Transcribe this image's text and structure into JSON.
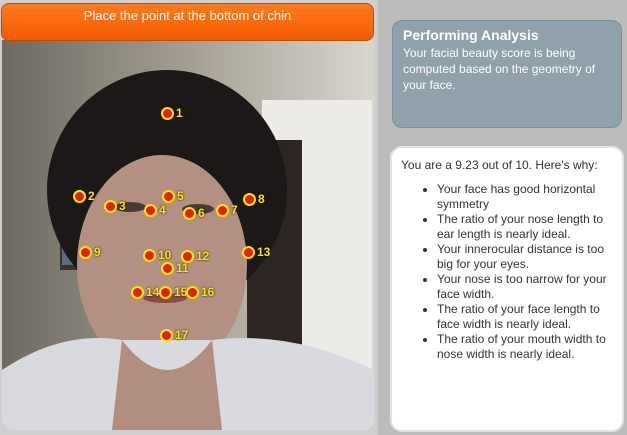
{
  "instruction_banner": "Place the point at the bottom of chin",
  "status": {
    "title": "Performing Analysis",
    "message": "Your facial beauty score is being computed based on the geometry of your face."
  },
  "result": {
    "summary": "You are a 9.23 out of 10.  Here's why:",
    "reasons": [
      "Your face has good horizontal symmetry",
      "The ratio of your nose length to ear length is nearly ideal.",
      "Your innerocular distance is too big for your eyes.",
      "Your nose is too narrow for your face width.",
      "The ratio of your face length to face width is nearly ideal.",
      "The ratio of your mouth width to nose width is nearly ideal."
    ]
  },
  "landmarks": [
    {
      "label": "1"
    },
    {
      "label": "2"
    },
    {
      "label": "3"
    },
    {
      "label": "4"
    },
    {
      "label": "5"
    },
    {
      "label": "6"
    },
    {
      "label": "7"
    },
    {
      "label": "8"
    },
    {
      "label": "9"
    },
    {
      "label": "10"
    },
    {
      "label": "11"
    },
    {
      "label": "12"
    },
    {
      "label": "13"
    },
    {
      "label": "14"
    },
    {
      "label": "15"
    },
    {
      "label": "16"
    },
    {
      "label": "17"
    }
  ],
  "colors": {
    "banner": "#f25c00",
    "marker": "#e0211b",
    "marker_ring": "#ffe400",
    "status_box": "#8fa1ab"
  }
}
